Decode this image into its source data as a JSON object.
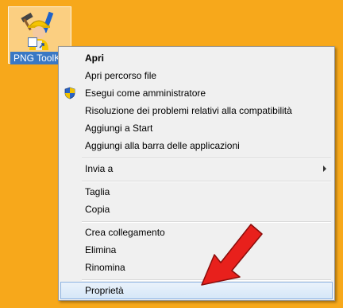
{
  "desktop": {
    "background_color": "#f7a81b",
    "shortcut": {
      "icon": "png-toolkit-worker-icon",
      "label": "PNG ToolKit"
    }
  },
  "context_menu": {
    "items": [
      {
        "label": "Apri",
        "bold": true
      },
      {
        "label": "Apri percorso file"
      },
      {
        "label": "Esegui come amministratore",
        "icon": "uac-shield-icon"
      },
      {
        "label": "Risoluzione dei problemi relativi alla compatibilità"
      },
      {
        "label": "Aggiungi a Start"
      },
      {
        "label": "Aggiungi alla barra delle applicazioni"
      },
      {
        "label": "Invia a",
        "submenu": true
      },
      {
        "label": "Taglia"
      },
      {
        "label": "Copia"
      },
      {
        "label": "Crea collegamento"
      },
      {
        "label": "Elimina"
      },
      {
        "label": "Rinomina"
      },
      {
        "label": "Proprietà",
        "highlighted": true
      }
    ]
  },
  "annotation": {
    "icon": "red-arrow-icon",
    "color": "#e8201c"
  }
}
